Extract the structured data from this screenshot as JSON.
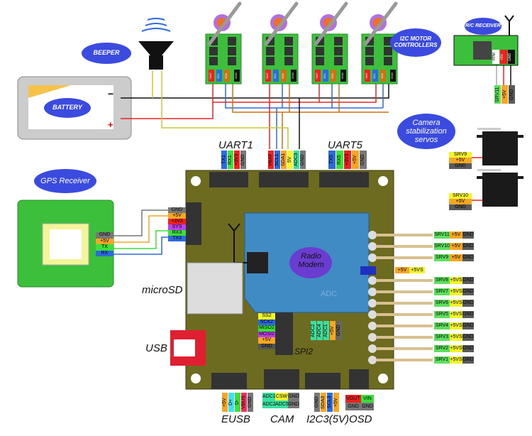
{
  "labels": {
    "beeper": "BEEPER",
    "battery": "BATTERY",
    "i2c": "I2C MOTOR CONTROLLERS",
    "rc": "R/C RECEIVER",
    "camera": "Camera stabilization servos",
    "gps": "GPS Receiver",
    "radio": "Radio Modem",
    "adc": "ADC",
    "spi2": "SPI2",
    "microsd": "microSD",
    "usb": "USB",
    "uart1": "UART1",
    "uart5": "UART5",
    "eusb": "EUSB",
    "cam": "CAM",
    "i2c3": "I2C3(5V)",
    "osd": "OSD",
    "minus": "−",
    "plus": "+"
  },
  "colors": {
    "board": "#6d6b1f",
    "modem": "#3d8fd8",
    "ellipse": "#3b4be0",
    "green": "#5de05d",
    "orange": "#f5a623",
    "yellow": "#f4f42a",
    "gray": "#5a5a5a",
    "red": "#f02020",
    "blue": "#2c6ae0"
  },
  "esc_pins": [
    "+BAT",
    "SCL",
    "SDA",
    "GND"
  ],
  "rc_pins": [
    "PPM",
    "+5V",
    "GND"
  ],
  "rc_out": [
    {
      "t": "SRV11",
      "c": "#5de05d"
    },
    {
      "t": "+5V",
      "c": "#f5a623"
    },
    {
      "t": "GND",
      "c": "#5a5a5a"
    }
  ],
  "cam_servo1": [
    {
      "t": "SRV9",
      "c": "#f4f42a"
    },
    {
      "t": "+5V",
      "c": "#f5a623"
    },
    {
      "t": "GND",
      "c": "#5a5a5a"
    }
  ],
  "cam_servo2": [
    {
      "t": "SRV10",
      "c": "#f4f42a"
    },
    {
      "t": "+5V",
      "c": "#f5a623"
    },
    {
      "t": "GND",
      "c": "#5a5a5a"
    }
  ],
  "uart1_pins": [
    {
      "t": "TX1",
      "c": "#2c6ae0"
    },
    {
      "t": "RX1",
      "c": "#3be03b"
    },
    {
      "t": "+3V3",
      "c": "#f02020"
    },
    {
      "t": "GND",
      "c": "#777"
    }
  ],
  "i2c_pins": [
    {
      "t": "VBAT",
      "c": "#f02020"
    },
    {
      "t": "SCL1",
      "c": "#2c6ae0"
    },
    {
      "t": "SDA1",
      "c": "#f5a623"
    },
    {
      "t": "5V",
      "c": "#f4f42a"
    },
    {
      "t": "ADC3",
      "c": "#3be0a0"
    },
    {
      "t": "GND",
      "c": "#777"
    }
  ],
  "uart5_pins": [
    {
      "t": "TX5",
      "c": "#2c6ae0"
    },
    {
      "t": "RX5",
      "c": "#3be03b"
    },
    {
      "t": "+3V3",
      "c": "#f02020"
    },
    {
      "t": "+5V",
      "c": "#f5a623"
    },
    {
      "t": "GND",
      "c": "#777"
    }
  ],
  "gps_pins": [
    {
      "t": "GND",
      "c": "#777"
    },
    {
      "t": "+5V",
      "c": "#f5a623"
    },
    {
      "t": "TX",
      "c": "#3be03b"
    },
    {
      "t": "RX",
      "c": "#2c6ae0"
    }
  ],
  "uart3_pins": [
    {
      "t": "GND",
      "c": "#777"
    },
    {
      "t": "+5V",
      "c": "#f5a623"
    },
    {
      "t": "+3V3",
      "c": "#f02020"
    },
    {
      "t": "SYS",
      "c": "#c040f0"
    },
    {
      "t": "RX3",
      "c": "#3be03b"
    },
    {
      "t": "TX3",
      "c": "#2c6ae0"
    }
  ],
  "jumper": [
    {
      "t": "+5V",
      "c": "#f5a623"
    },
    {
      "t": "+5VS",
      "c": "#f4f42a"
    }
  ],
  "servos": [
    {
      "s": "SRV11",
      "p": "+5V",
      "pc": "#f5a623"
    },
    {
      "s": "SRV10",
      "p": "+5V",
      "pc": "#f5a623"
    },
    {
      "s": "SRV9",
      "p": "+5V",
      "pc": "#f5a623"
    },
    {
      "s": "SRV8",
      "p": "+5VS",
      "pc": "#f4f42a"
    },
    {
      "s": "SRV7",
      "p": "+5VS",
      "pc": "#f4f42a"
    },
    {
      "s": "SRV6",
      "p": "+5VS",
      "pc": "#f4f42a"
    },
    {
      "s": "SRV5",
      "p": "+5VS",
      "pc": "#f4f42a"
    },
    {
      "s": "SRV4",
      "p": "+5VS",
      "pc": "#f4f42a"
    },
    {
      "s": "SRV3",
      "p": "+5VS",
      "pc": "#f4f42a"
    },
    {
      "s": "SRV2",
      "p": "+5VS",
      "pc": "#f4f42a"
    },
    {
      "s": "SRV1",
      "p": "+5VS",
      "pc": "#f4f42a"
    }
  ],
  "servo_gnd": "GND",
  "spi2_pins": [
    {
      "t": "SS2",
      "c": "#f4f42a"
    },
    {
      "t": "SCK2",
      "c": "#2c6ae0"
    },
    {
      "t": "MISO2",
      "c": "#3be03b"
    },
    {
      "t": "MOSI2",
      "c": "#c040f0"
    },
    {
      "t": "+5V",
      "c": "#f5a623"
    },
    {
      "t": "GND",
      "c": "#555"
    }
  ],
  "adc_pins": [
    {
      "t": "ADC2",
      "c": "#3be0a0"
    },
    {
      "t": "ADC4",
      "c": "#3be0a0"
    },
    {
      "t": "ADC1",
      "c": "#3be0a0"
    },
    {
      "t": "+5V",
      "c": "#f5a623"
    },
    {
      "t": "GND",
      "c": "#666"
    }
  ],
  "eusb_pins": [
    {
      "t": "+5V",
      "c": "#f5a623"
    },
    {
      "t": "D+",
      "c": "#40e0f0"
    },
    {
      "t": "D-",
      "c": "#3be03b"
    },
    {
      "t": "VBUS",
      "c": "#f03060"
    },
    {
      "t": "GND",
      "c": "#777"
    }
  ],
  "cam_pins": [
    {
      "t": "ADC1",
      "c": "#3be0a0"
    },
    {
      "t": "CSW",
      "c": "#f4f42a"
    },
    {
      "t": "GND",
      "c": "#777"
    },
    {
      "t": "ADC2",
      "c": "#3be0a0"
    },
    {
      "t": "ADC5",
      "c": "#3be0a0"
    },
    {
      "t": "GND",
      "c": "#777"
    }
  ],
  "i2c3_pins": [
    {
      "t": "GND",
      "c": "#777"
    },
    {
      "t": "SDA3",
      "c": "#f5a623"
    },
    {
      "t": "SCL3",
      "c": "#2c6ae0"
    },
    {
      "t": "+5V",
      "c": "#f5a623"
    }
  ],
  "osd_pins": [
    {
      "t": "VOUT",
      "c": "#f02020"
    },
    {
      "t": "VIN",
      "c": "#3be03b"
    },
    {
      "t": "GND",
      "c": "#777"
    },
    {
      "t": "GND",
      "c": "#777"
    }
  ]
}
